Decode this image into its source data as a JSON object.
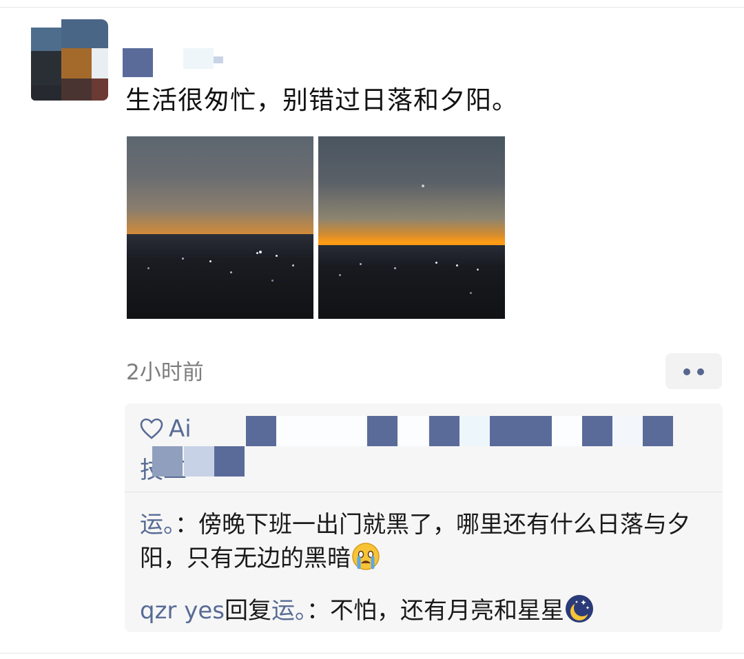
{
  "post": {
    "text": "生活很匆忙，别错过日落和夕阳。",
    "time": "2小时前",
    "photos": [
      "sunset-photo-1",
      "sunset-photo-2"
    ]
  },
  "likes": {
    "icon": "heart-icon",
    "line1_visible": "Ai",
    "line1_end": "宇",
    "line2_visible": "技工"
  },
  "comments": [
    {
      "author": "运。",
      "sep": "：",
      "text": "傍晚下班一出门就黑了，哪里还有什么日落与夕阳，只有无边的黑暗",
      "emoji": "crying-face-emoji"
    },
    {
      "author": "qzr yes",
      "reply_word": "回复",
      "reply_to": "运。",
      "sep": "：",
      "text": "不怕，还有月亮和星星",
      "emoji": "crescent-moon-emoji"
    }
  ],
  "colors": {
    "link": "#576b95",
    "time": "#7d7d7d",
    "comment_bg": "#f6f6f6"
  }
}
